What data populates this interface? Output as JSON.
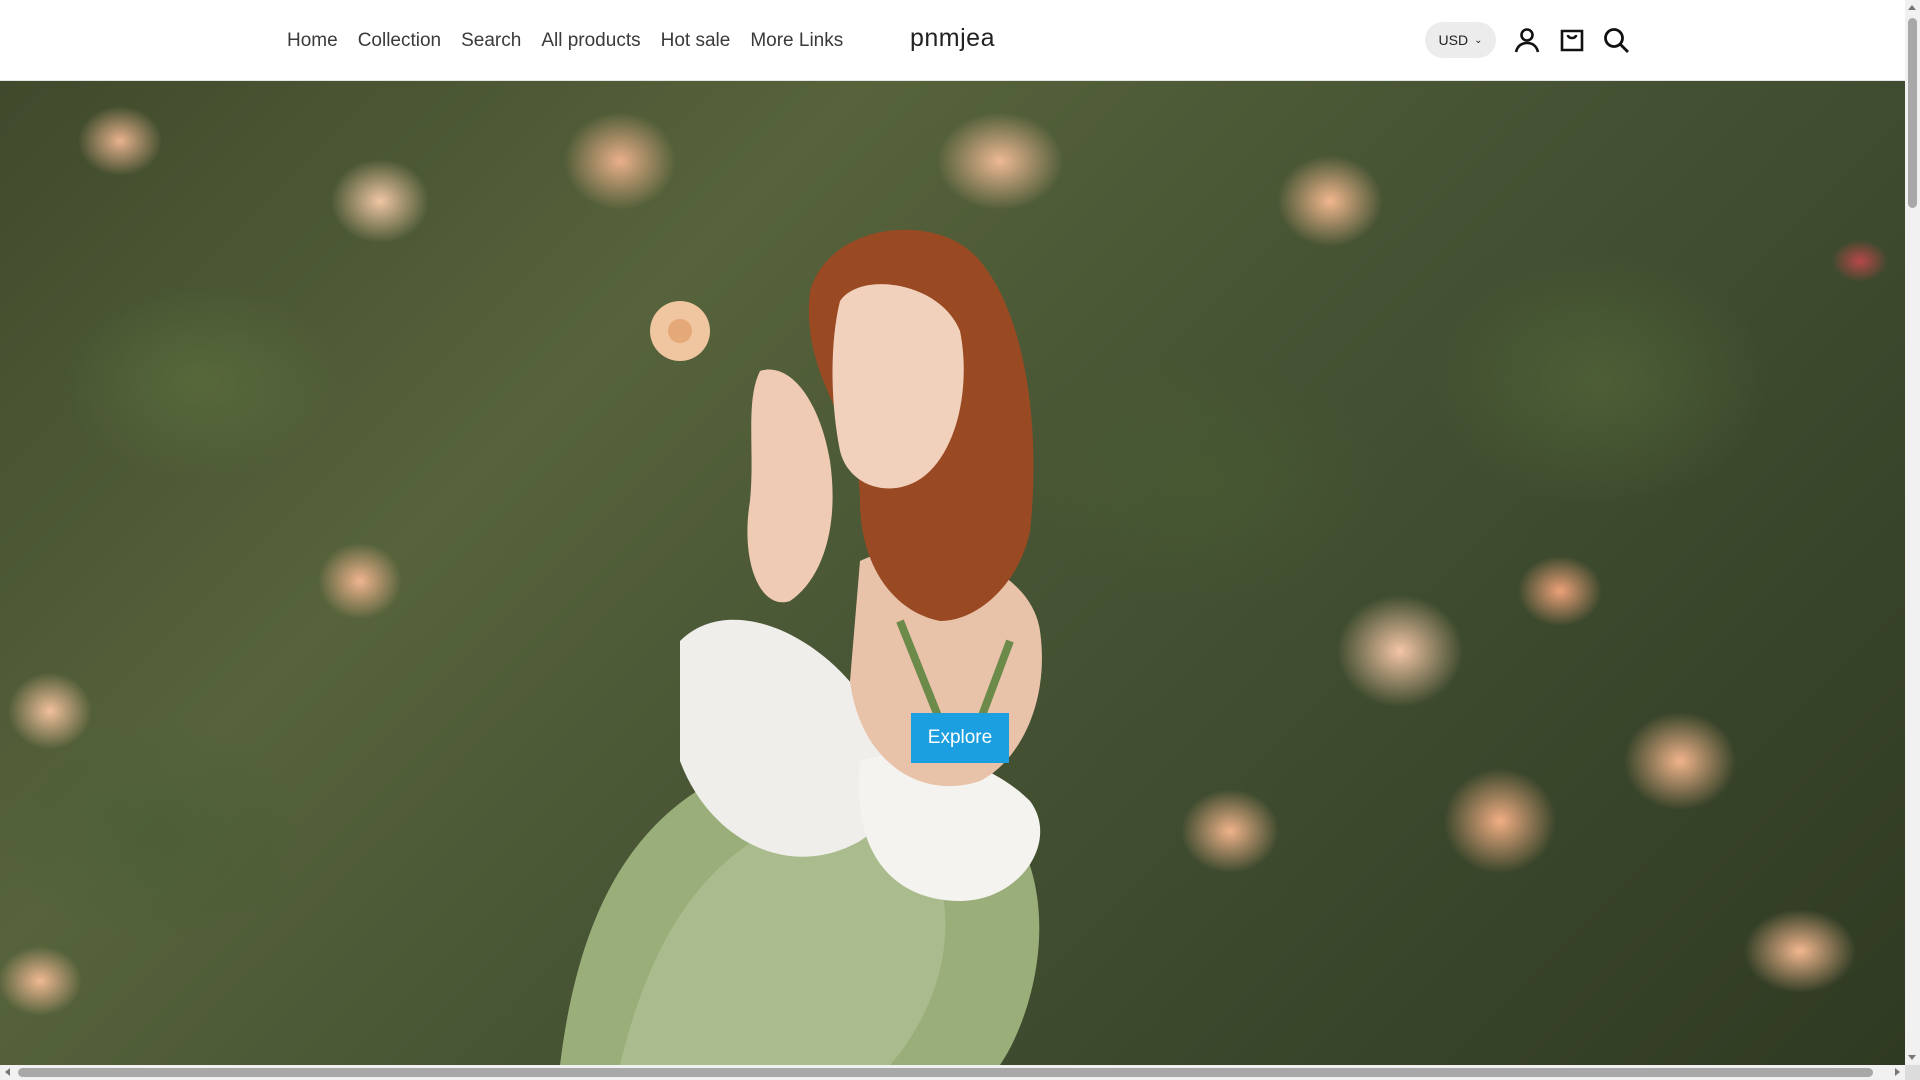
{
  "header": {
    "nav": [
      "Home",
      "Collection",
      "Search",
      "All products",
      "Hot sale",
      "More Links"
    ],
    "brand": "pnmjea",
    "currency": "USD",
    "icons": [
      "account-icon",
      "cart-icon",
      "search-icon"
    ]
  },
  "hero": {
    "cta_label": "Explore",
    "cta_color": "#1b9fe0"
  }
}
